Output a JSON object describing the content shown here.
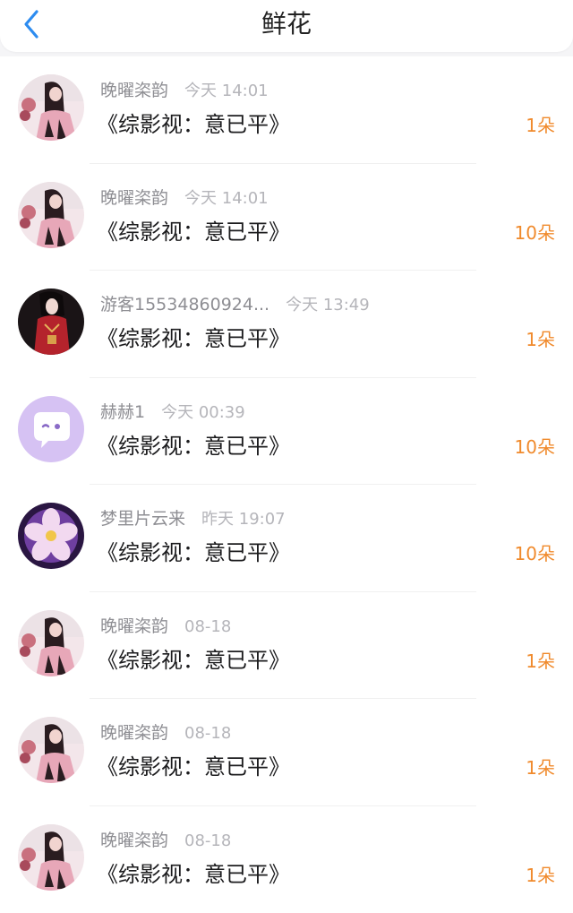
{
  "header": {
    "title": "鲜花",
    "back_icon": "chevron-left-icon",
    "accent": "#2d8cf0"
  },
  "colors": {
    "quantity": "#f08a2c",
    "name": "#8e8e93",
    "time": "#b5b5ba"
  },
  "items": [
    {
      "name": "晚曜栥韵",
      "time": "今天 14:01",
      "book": "《综影视：意已平》",
      "qty": "1朵",
      "avatar": "photo-girl-pink"
    },
    {
      "name": "晚曜栥韵",
      "time": "今天 14:01",
      "book": "《综影视：意已平》",
      "qty": "10朵",
      "avatar": "photo-girl-pink"
    },
    {
      "name": "游客15534860924...",
      "time": "今天 13:49",
      "book": "《综影视：意已平》",
      "qty": "1朵",
      "avatar": "photo-girl-red"
    },
    {
      "name": "赫赫1",
      "time": "今天 00:39",
      "book": "《综影视：意已平》",
      "qty": "10朵",
      "avatar": "chat-bubble-icon"
    },
    {
      "name": "梦里片云来",
      "time": "昨天 19:07",
      "book": "《综影视：意已平》",
      "qty": "10朵",
      "avatar": "flower-photo"
    },
    {
      "name": "晚曜栥韵",
      "time": "08-18",
      "book": "《综影视：意已平》",
      "qty": "1朵",
      "avatar": "photo-girl-pink"
    },
    {
      "name": "晚曜栥韵",
      "time": "08-18",
      "book": "《综影视：意已平》",
      "qty": "1朵",
      "avatar": "photo-girl-pink"
    },
    {
      "name": "晚曜栥韵",
      "time": "08-18",
      "book": "《综影视：意已平》",
      "qty": "1朵",
      "avatar": "photo-girl-pink"
    }
  ]
}
